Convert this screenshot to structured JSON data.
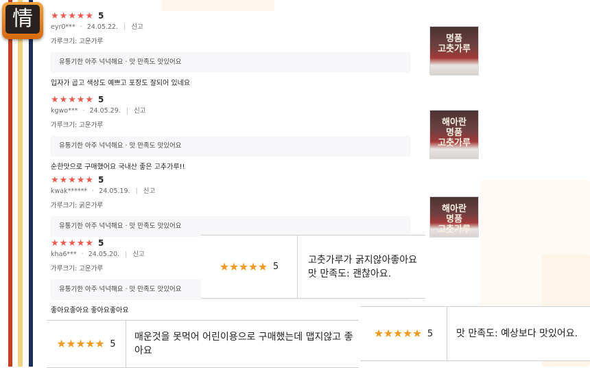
{
  "logo": {
    "glyph": "情"
  },
  "colors": {
    "star": "#f0584e",
    "overlay_star": "#f39a1e",
    "stripe_red": "#c8401f",
    "stripe_yellow": "#f2d27a",
    "stripe_navy": "#1c2d5c"
  },
  "reviews": [
    {
      "stars": 5,
      "score": "5",
      "user": "eyr0***",
      "date": "24.05.22.",
      "report": "신고",
      "option": "가루크기: 고운가루",
      "tags": "유통기한 아주 넉넉해요 · 맛 만족도 맛있어요",
      "text": "입자가 곱고 색상도 예쁘고 포장도 잘되어 있네요"
    },
    {
      "stars": 5,
      "score": "5",
      "user": "kgwo***",
      "date": "24.05.29.",
      "report": "신고",
      "option": "가루크기: 고운가루",
      "tags": "유통기한 아주 넉넉해요 · 맛 만족도 맛있어요",
      "text": "순한맛으로 구매했어요 국내산 좋은 고추가루!!"
    },
    {
      "stars": 5,
      "score": "5",
      "user": "kwak******",
      "date": "24.05.19.",
      "report": "신고",
      "option": "가루크기: 굵은가루",
      "tags": "유통기한 아주 넉넉해요 · 맛 만족도 맛있어요",
      "text": ""
    },
    {
      "stars": 5,
      "score": "5",
      "user": "kha6***",
      "date": "24.05.20.",
      "report": "신고",
      "option": "가루크기: 고운가루",
      "tags": "유통기한 아주 넉넉해요 · 맛 만족도 맛있어요",
      "text": "좋아요좋아요 좋아요좋아요"
    }
  ],
  "thumbnails": [
    {
      "caption": "명품\n고춧가루"
    },
    {
      "caption": "해아란\n명품\n고춧가루"
    },
    {
      "caption": "해아란\n명품\n고춧가루"
    }
  ],
  "overlays": [
    {
      "stars": 5,
      "score": "5",
      "text": "고춧가루가 굵지않아좋아요\n맛 만족도: 괜찮아요."
    },
    {
      "stars": 5,
      "score": "5",
      "text": "맛 만족도: 예상보다 맛있어요."
    },
    {
      "stars": 5,
      "score": "5",
      "text": "매운것을 못먹어 어린이용으로 구매했는데 맵지않고 좋아요"
    }
  ]
}
